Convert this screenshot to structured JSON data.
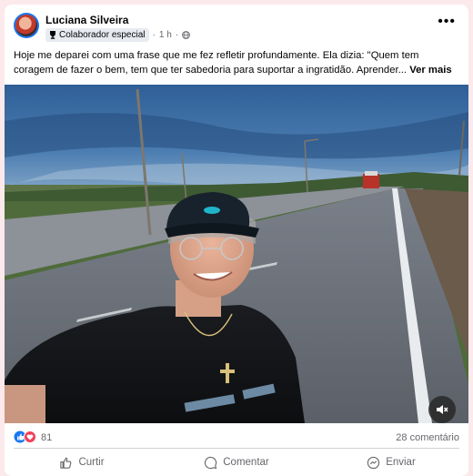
{
  "post": {
    "author": "Luciana Silveira",
    "badge_label": "Colaborador especial",
    "time": "1 h",
    "separator": "·",
    "text": "Hoje me deparei com uma frase que me fez refletir profundamente. Ela dizia: \"Quem tem coragem de fazer o bem, tem que ter sabedoria para suportar a ingratidão. Aprender...",
    "see_more": "Ver mais"
  },
  "stats": {
    "reactions_count": "81",
    "comments": "28 comentário"
  },
  "actions": {
    "like": "Curtir",
    "comment": "Comentar",
    "share": "Enviar"
  },
  "colors": {
    "accent": "#1877f2",
    "page_background": "#fbe9ec",
    "secondary_text": "#65676b"
  },
  "icons": [
    "trophy-icon",
    "globe-icon",
    "more-options-icon",
    "mute-icon",
    "like-reaction-icon",
    "love-reaction-icon",
    "like-icon",
    "comment-icon",
    "share-icon"
  ]
}
